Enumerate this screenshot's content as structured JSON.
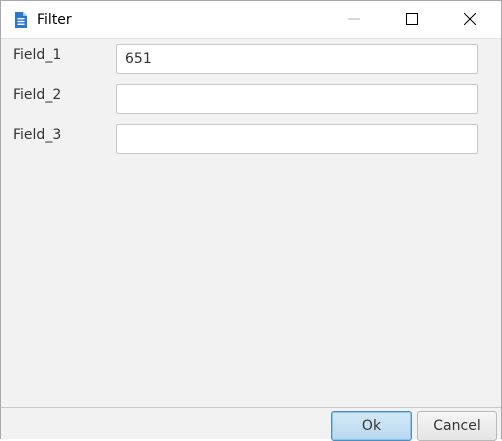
{
  "window": {
    "title": "Filter"
  },
  "icons": {
    "app": "document-icon",
    "minimize": "minimize-icon",
    "maximize": "maximize-icon",
    "close": "close-icon"
  },
  "form": {
    "fields": [
      {
        "label": "Field_1",
        "value": "651",
        "placeholder": ""
      },
      {
        "label": "Field_2",
        "value": "",
        "placeholder": ""
      },
      {
        "label": "Field_3",
        "value": "",
        "placeholder": ""
      }
    ]
  },
  "buttons": {
    "ok": "Ok",
    "cancel": "Cancel"
  },
  "colors": {
    "accent": "#4a90c2",
    "icon_blue": "#2b78d4",
    "background": "#f2f2f2"
  }
}
